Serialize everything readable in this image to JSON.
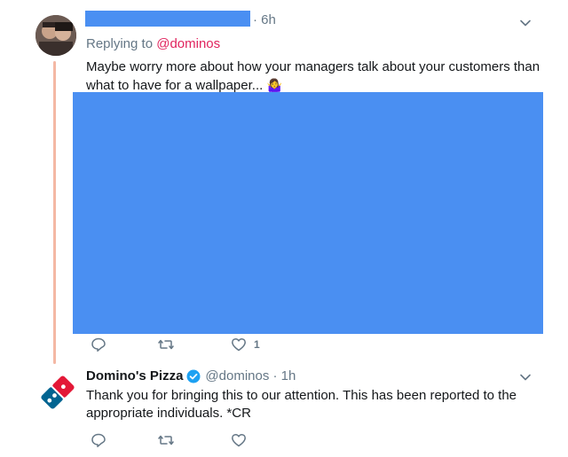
{
  "tweet1": {
    "time": "· 6h",
    "replying_prefix": "Replying to",
    "replying_handle": "@dominos",
    "text_line1": "Maybe worry more about how your managers talk about your customers than",
    "text_line2": "what to have for a wallpaper...",
    "emoji": "🤷‍♀️",
    "actions": {
      "reply_icon": "reply-icon",
      "retweet_icon": "retweet-icon",
      "like_icon": "heart-icon",
      "like_count": "1"
    }
  },
  "tweet2": {
    "name": "Domino's Pizza",
    "verified_icon": "verified-badge-icon",
    "handle_time": "@dominos · 1h",
    "text_line1": "Thank you for bringing this to our attention. This has been reported to the",
    "text_line2": "appropriate individuals. *CR",
    "actions": {
      "reply_icon": "reply-icon",
      "retweet_icon": "retweet-icon",
      "like_icon": "heart-icon"
    }
  },
  "colors": {
    "link": "#e0245e",
    "redaction": "#4a8ff2",
    "thread_line": "#f4b8a4",
    "verified": "#1da1f2",
    "domino_blue": "#006491",
    "domino_red": "#e31837"
  }
}
